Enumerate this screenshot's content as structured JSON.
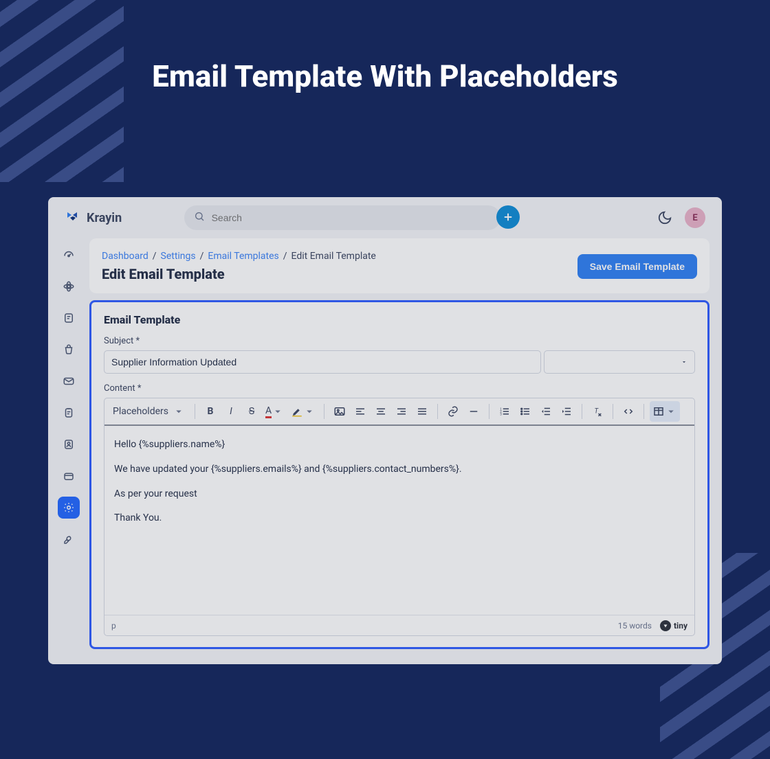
{
  "hero": {
    "title": "Email Template With Placeholders"
  },
  "brand": {
    "name": "Krayin"
  },
  "search": {
    "placeholder": "Search",
    "value": ""
  },
  "avatar": {
    "initial": "E"
  },
  "breadcrumbs": {
    "items": [
      "Dashboard",
      "Settings",
      "Email Templates"
    ],
    "current": "Edit Email Template",
    "sep": "/"
  },
  "page": {
    "heading": "Edit Email Template",
    "save_button": "Save Email Template"
  },
  "panel": {
    "title": "Email Template"
  },
  "subject": {
    "label": "Subject *",
    "value": "Supplier Information Updated",
    "variable_selected": ""
  },
  "content": {
    "label": "Content *",
    "toolbar": {
      "placeholders_label": "Placeholders"
    },
    "body_lines": [
      "Hello {%suppliers.name%}",
      "We have updated your {%suppliers.emails%} and {%suppliers.contact_numbers%}.",
      "As per your request",
      "Thank You."
    ],
    "status": {
      "path": "p",
      "word_count": "15 words",
      "brand": "tiny"
    }
  },
  "sidebar": {
    "items": [
      {
        "icon": "gauge"
      },
      {
        "icon": "atom"
      },
      {
        "icon": "note"
      },
      {
        "icon": "bag"
      },
      {
        "icon": "mail"
      },
      {
        "icon": "clipboard"
      },
      {
        "icon": "contacts"
      },
      {
        "icon": "box"
      },
      {
        "icon": "gear",
        "active": true
      },
      {
        "icon": "wrench"
      }
    ]
  }
}
